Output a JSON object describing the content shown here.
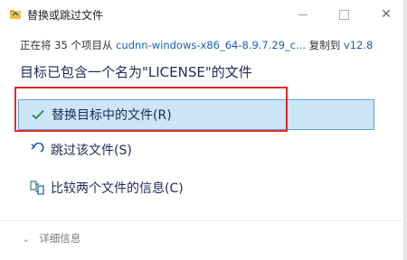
{
  "window": {
    "title": "替换或跳过文件",
    "minimize_icon": "minimize-icon",
    "maximize_icon": "maximize-icon",
    "close_glyph": "✕"
  },
  "progress": {
    "prefix": "正在将 35 个项目从 ",
    "source": "cudnn-windows-x86_64-8.9.7.29_c...",
    "middle": " 复制到 ",
    "destination": "v12.8"
  },
  "headline": "目标已包含一个名为\"LICENSE\"的文件",
  "options": {
    "replace": {
      "label": "替换目标中的文件(R)",
      "icon": "checkmark-icon"
    },
    "skip": {
      "label": "跳过该文件(S)",
      "icon": "skip-arrow-icon"
    },
    "compare": {
      "label": "比较两个文件的信息(C)",
      "icon": "compare-icon"
    }
  },
  "details": {
    "label": "详细信息",
    "chevron": "⌄"
  },
  "colors": {
    "accent": "#1a5fb4",
    "selected_bg": "#cce6f8",
    "selected_border": "#5aa6e0",
    "highlight_box": "#e0282e",
    "check_green": "#2e8b57"
  }
}
